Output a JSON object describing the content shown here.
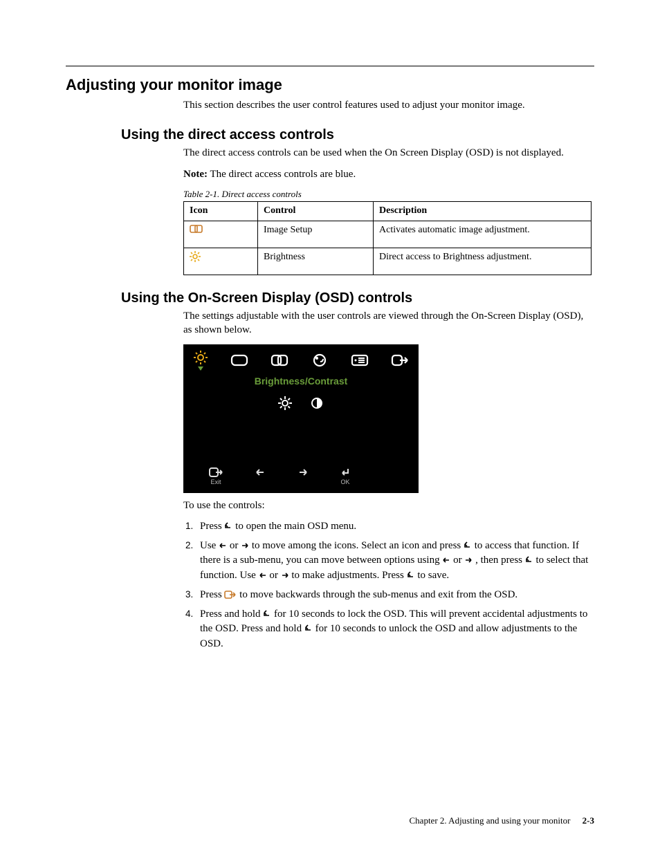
{
  "h1": "Adjusting your monitor image",
  "intro": "This section describes the user control features used to adjust your monitor image.",
  "h2a": "Using the direct access controls",
  "direct_intro": "The direct access controls can be used when the On Screen Display (OSD) is not displayed.",
  "note_label": "Note:",
  "note_body": " The direct access controls are blue.",
  "table_caption": "Table 2-1. Direct access controls",
  "th": {
    "icon": "Icon",
    "control": "Control",
    "desc": "Description"
  },
  "rows": [
    {
      "control": "Image Setup",
      "desc": "Activates automatic image adjustment."
    },
    {
      "control": "Brightness",
      "desc": "Direct access to Brightness adjustment."
    }
  ],
  "h2b": "Using the On-Screen Display (OSD) controls",
  "osd_intro": "The settings adjustable with the user controls are viewed through the On-Screen Display (OSD), as shown below.",
  "osd_title": "Brightness/Contrast",
  "osd_exit": "Exit",
  "osd_ok": "OK",
  "controls_lead": "To use the controls:",
  "step1_a": "Press ",
  "step1_b": " to open the main OSD menu.",
  "step2_a": "Use ",
  "step2_b": " or ",
  "step2_c": " to move among the icons. Select an icon and press ",
  "step2_d": " to access that function. If there is a sub-menu, you can move between options using ",
  "step2_e": " or ",
  "step2_f": " , then press ",
  "step2_g": " to select that function. Use ",
  "step2_h": " or ",
  "step2_i": " to make adjustments. Press ",
  "step2_j": " to save.",
  "step3_a": "Press ",
  "step3_b": " to move backwards through the sub-menus and exit from the OSD.",
  "step4_a": "Press and hold ",
  "step4_b": " for 10 seconds to lock the OSD. This will prevent accidental adjustments to the OSD. Press and hold ",
  "step4_c": " for 10 seconds to unlock the OSD and allow adjustments to the OSD.",
  "footer_chapter": "Chapter 2. Adjusting and using your monitor",
  "footer_page": "2-3"
}
